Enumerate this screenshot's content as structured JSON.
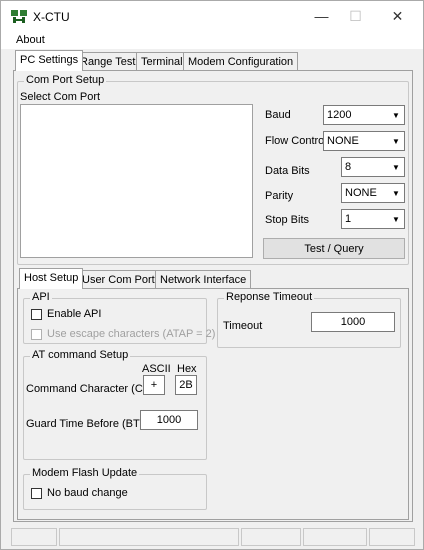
{
  "window": {
    "title": "X-CTU",
    "minimize_glyph": "—",
    "maximize_glyph": "☐",
    "close_glyph": "✕"
  },
  "menu": {
    "about": "About"
  },
  "main_tabs": [
    {
      "label": "PC Settings"
    },
    {
      "label": "Range Test"
    },
    {
      "label": "Terminal"
    },
    {
      "label": "Modem Configuration"
    }
  ],
  "com_port_setup": {
    "title": "Com Port Setup",
    "select_label": "Select Com Port",
    "baud_label": "Baud",
    "baud_value": "1200",
    "flow_label": "Flow Control",
    "flow_value": "NONE",
    "data_bits_label": "Data Bits",
    "data_bits_value": "8",
    "parity_label": "Parity",
    "parity_value": "NONE",
    "stop_bits_label": "Stop Bits",
    "stop_bits_value": "1",
    "test_button": "Test  / Query"
  },
  "sub_tabs": [
    {
      "label": "Host Setup"
    },
    {
      "label": "User Com Ports"
    },
    {
      "label": "Network Interface"
    }
  ],
  "api": {
    "title": "API",
    "enable_label": "Enable API",
    "escape_label": "Use escape characters (ATAP = 2)"
  },
  "timeout": {
    "title": "Reponse Timeout",
    "label": "Timeout",
    "value": "1000"
  },
  "at_command": {
    "title": "AT command Setup",
    "ascii_header": "ASCII",
    "hex_header": "Hex",
    "cc_label": "Command Character (CC)",
    "cc_ascii": "+",
    "cc_hex": "2B",
    "bt_label": "Guard Time Before (BT)",
    "bt_value": "1000"
  },
  "modem_flash": {
    "title": "Modem Flash Update",
    "no_baud_label": "No baud change"
  },
  "colors": {
    "window_bg": "#f0f0f0",
    "border": "#a0a0a0"
  }
}
